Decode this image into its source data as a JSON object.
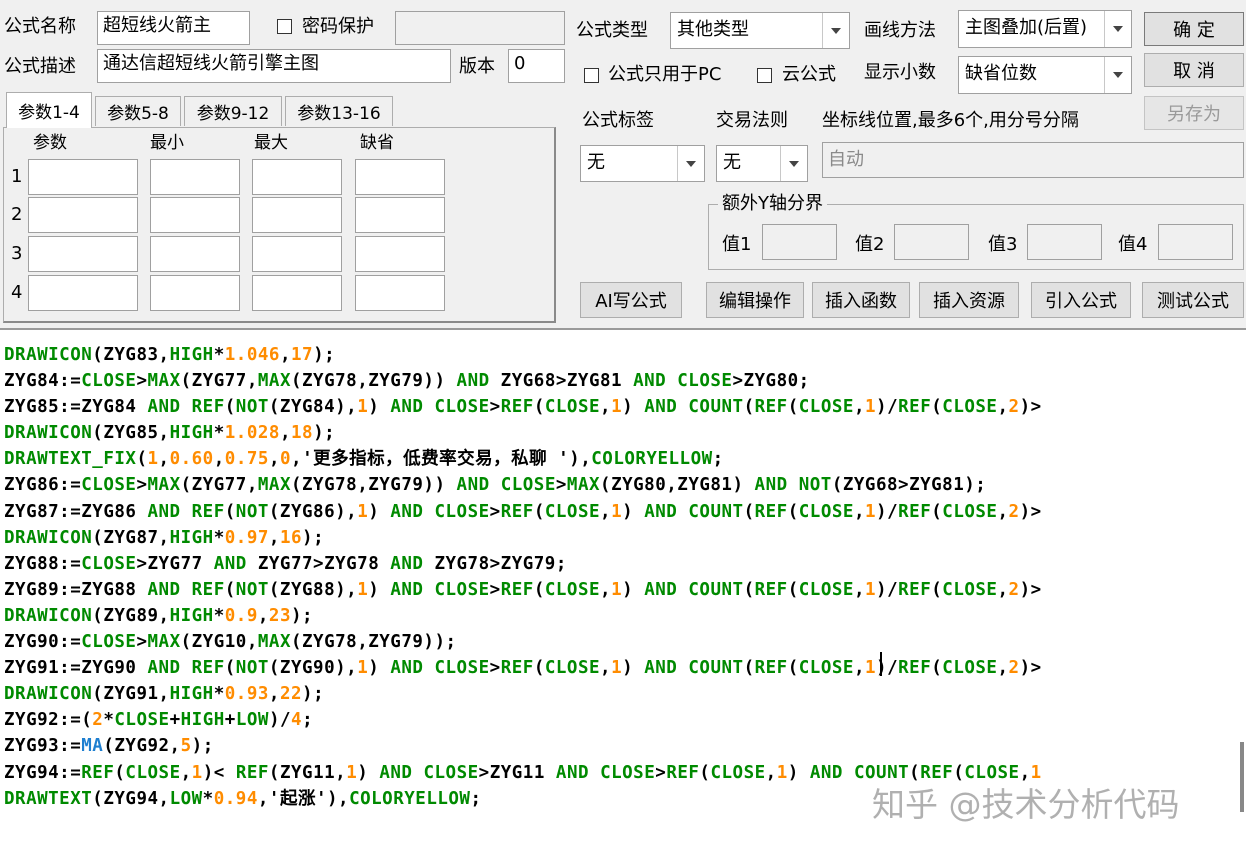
{
  "header": {
    "name_label": "公式名称",
    "name_value": "超短线火箭主",
    "password_label": "密码保护",
    "password_value": "",
    "desc_label": "公式描述",
    "desc_value": "通达信超短线火箭引擎主图",
    "version_label": "版本",
    "version_value": "0",
    "type_label": "公式类型",
    "type_value": "其他类型",
    "draw_label": "画线方法",
    "draw_value": "主图叠加(后置)",
    "pc_only_label": "公式只用于PC",
    "cloud_label": "云公式",
    "decimal_label": "显示小数",
    "decimal_value": "缺省位数"
  },
  "buttons": {
    "ok": "确  定",
    "cancel": "取  消",
    "save_as": "另存为"
  },
  "tabs": [
    {
      "label": "参数1-4",
      "active": true
    },
    {
      "label": "参数5-8",
      "active": false
    },
    {
      "label": "参数9-12",
      "active": false
    },
    {
      "label": "参数13-16",
      "active": false
    }
  ],
  "params": {
    "col_param": "参数",
    "col_min": "最小",
    "col_max": "最大",
    "col_default": "缺省",
    "rows": [
      "1",
      "2",
      "3",
      "4"
    ]
  },
  "right": {
    "tag_label": "公式标签",
    "tag_value": "无",
    "rule_label": "交易法则",
    "rule_value": "无",
    "axis_label": "坐标线位置,最多6个,用分号分隔",
    "axis_value": "自动",
    "extra_y_label": "额外Y轴分界",
    "v1_label": "值1",
    "v2_label": "值2",
    "v3_label": "值3",
    "v4_label": "值4"
  },
  "toolbar": {
    "ai": "AI写公式",
    "edit": "编辑操作",
    "insert_func": "插入函数",
    "insert_res": "插入资源",
    "import": "引入公式",
    "test": "测试公式"
  },
  "code_colors": {
    "normal": "#000000",
    "keyword": "#008a00",
    "number": "#ff8c00",
    "function_blue": "#1e7fd0"
  },
  "code_lines": [
    [
      [
        "g",
        "DRAWICON"
      ],
      [
        "n",
        "(ZYG83,"
      ],
      [
        "g",
        "HIGH"
      ],
      [
        "n",
        "*"
      ],
      [
        "o",
        "1.046"
      ],
      [
        "n",
        ","
      ],
      [
        "o",
        "17"
      ],
      [
        "n",
        ");"
      ]
    ],
    [
      [
        "n",
        "ZYG84:="
      ],
      [
        "g",
        "CLOSE"
      ],
      [
        "n",
        ">"
      ],
      [
        "g",
        "MAX"
      ],
      [
        "n",
        "(ZYG77,"
      ],
      [
        "g",
        "MAX"
      ],
      [
        "n",
        "(ZYG78,ZYG79)) "
      ],
      [
        "g",
        "AND"
      ],
      [
        "n",
        " ZYG68>ZYG81 "
      ],
      [
        "g",
        "AND"
      ],
      [
        "n",
        " "
      ],
      [
        "g",
        "CLOSE"
      ],
      [
        "n",
        ">ZYG80;"
      ]
    ],
    [
      [
        "n",
        "ZYG85:=ZYG84 "
      ],
      [
        "g",
        "AND"
      ],
      [
        "n",
        " "
      ],
      [
        "g",
        "REF"
      ],
      [
        "n",
        "("
      ],
      [
        "g",
        "NOT"
      ],
      [
        "n",
        "(ZYG84),"
      ],
      [
        "o",
        "1"
      ],
      [
        "n",
        ") "
      ],
      [
        "g",
        "AND"
      ],
      [
        "n",
        " "
      ],
      [
        "g",
        "CLOSE"
      ],
      [
        "n",
        ">"
      ],
      [
        "g",
        "REF"
      ],
      [
        "n",
        "("
      ],
      [
        "g",
        "CLOSE"
      ],
      [
        "n",
        ","
      ],
      [
        "o",
        "1"
      ],
      [
        "n",
        ") "
      ],
      [
        "g",
        "AND"
      ],
      [
        "n",
        " "
      ],
      [
        "g",
        "COUNT"
      ],
      [
        "n",
        "("
      ],
      [
        "g",
        "REF"
      ],
      [
        "n",
        "("
      ],
      [
        "g",
        "CLOSE"
      ],
      [
        "n",
        ","
      ],
      [
        "o",
        "1"
      ],
      [
        "n",
        ")/"
      ],
      [
        "g",
        "REF"
      ],
      [
        "n",
        "("
      ],
      [
        "g",
        "CLOSE"
      ],
      [
        "n",
        ","
      ],
      [
        "o",
        "2"
      ],
      [
        "n",
        ")>"
      ]
    ],
    [
      [
        "g",
        "DRAWICON"
      ],
      [
        "n",
        "(ZYG85,"
      ],
      [
        "g",
        "HIGH"
      ],
      [
        "n",
        "*"
      ],
      [
        "o",
        "1.028"
      ],
      [
        "n",
        ","
      ],
      [
        "o",
        "18"
      ],
      [
        "n",
        ");"
      ]
    ],
    [
      [
        "g",
        "DRAWTEXT_FIX"
      ],
      [
        "n",
        "("
      ],
      [
        "o",
        "1"
      ],
      [
        "n",
        ","
      ],
      [
        "o",
        "0.60"
      ],
      [
        "n",
        ","
      ],
      [
        "o",
        "0.75"
      ],
      [
        "n",
        ","
      ],
      [
        "o",
        "0"
      ],
      [
        "n",
        ",'更多指标，低费率交易，私聊 '),"
      ],
      [
        "g",
        "COLORYELLOW"
      ],
      [
        "n",
        ";"
      ]
    ],
    [
      [
        "n",
        "ZYG86:="
      ],
      [
        "g",
        "CLOSE"
      ],
      [
        "n",
        ">"
      ],
      [
        "g",
        "MAX"
      ],
      [
        "n",
        "(ZYG77,"
      ],
      [
        "g",
        "MAX"
      ],
      [
        "n",
        "(ZYG78,ZYG79)) "
      ],
      [
        "g",
        "AND"
      ],
      [
        "n",
        " "
      ],
      [
        "g",
        "CLOSE"
      ],
      [
        "n",
        ">"
      ],
      [
        "g",
        "MAX"
      ],
      [
        "n",
        "(ZYG80,ZYG81) "
      ],
      [
        "g",
        "AND"
      ],
      [
        "n",
        " "
      ],
      [
        "g",
        "NOT"
      ],
      [
        "n",
        "(ZYG68>ZYG81);"
      ]
    ],
    [
      [
        "n",
        "ZYG87:=ZYG86 "
      ],
      [
        "g",
        "AND"
      ],
      [
        "n",
        " "
      ],
      [
        "g",
        "REF"
      ],
      [
        "n",
        "("
      ],
      [
        "g",
        "NOT"
      ],
      [
        "n",
        "(ZYG86),"
      ],
      [
        "o",
        "1"
      ],
      [
        "n",
        ") "
      ],
      [
        "g",
        "AND"
      ],
      [
        "n",
        " "
      ],
      [
        "g",
        "CLOSE"
      ],
      [
        "n",
        ">"
      ],
      [
        "g",
        "REF"
      ],
      [
        "n",
        "("
      ],
      [
        "g",
        "CLOSE"
      ],
      [
        "n",
        ","
      ],
      [
        "o",
        "1"
      ],
      [
        "n",
        ") "
      ],
      [
        "g",
        "AND"
      ],
      [
        "n",
        " "
      ],
      [
        "g",
        "COUNT"
      ],
      [
        "n",
        "("
      ],
      [
        "g",
        "REF"
      ],
      [
        "n",
        "("
      ],
      [
        "g",
        "CLOSE"
      ],
      [
        "n",
        ","
      ],
      [
        "o",
        "1"
      ],
      [
        "n",
        ")/"
      ],
      [
        "g",
        "REF"
      ],
      [
        "n",
        "("
      ],
      [
        "g",
        "CLOSE"
      ],
      [
        "n",
        ","
      ],
      [
        "o",
        "2"
      ],
      [
        "n",
        ")>"
      ]
    ],
    [
      [
        "g",
        "DRAWICON"
      ],
      [
        "n",
        "(ZYG87,"
      ],
      [
        "g",
        "HIGH"
      ],
      [
        "n",
        "*"
      ],
      [
        "o",
        "0.97"
      ],
      [
        "n",
        ","
      ],
      [
        "o",
        "16"
      ],
      [
        "n",
        ");"
      ]
    ],
    [
      [
        "n",
        "ZYG88:="
      ],
      [
        "g",
        "CLOSE"
      ],
      [
        "n",
        ">ZYG77 "
      ],
      [
        "g",
        "AND"
      ],
      [
        "n",
        " ZYG77>ZYG78 "
      ],
      [
        "g",
        "AND"
      ],
      [
        "n",
        " ZYG78>ZYG79;"
      ]
    ],
    [
      [
        "n",
        "ZYG89:=ZYG88 "
      ],
      [
        "g",
        "AND"
      ],
      [
        "n",
        " "
      ],
      [
        "g",
        "REF"
      ],
      [
        "n",
        "("
      ],
      [
        "g",
        "NOT"
      ],
      [
        "n",
        "(ZYG88),"
      ],
      [
        "o",
        "1"
      ],
      [
        "n",
        ") "
      ],
      [
        "g",
        "AND"
      ],
      [
        "n",
        " "
      ],
      [
        "g",
        "CLOSE"
      ],
      [
        "n",
        ">"
      ],
      [
        "g",
        "REF"
      ],
      [
        "n",
        "("
      ],
      [
        "g",
        "CLOSE"
      ],
      [
        "n",
        ","
      ],
      [
        "o",
        "1"
      ],
      [
        "n",
        ") "
      ],
      [
        "g",
        "AND"
      ],
      [
        "n",
        " "
      ],
      [
        "g",
        "COUNT"
      ],
      [
        "n",
        "("
      ],
      [
        "g",
        "REF"
      ],
      [
        "n",
        "("
      ],
      [
        "g",
        "CLOSE"
      ],
      [
        "n",
        ","
      ],
      [
        "o",
        "1"
      ],
      [
        "n",
        ")/"
      ],
      [
        "g",
        "REF"
      ],
      [
        "n",
        "("
      ],
      [
        "g",
        "CLOSE"
      ],
      [
        "n",
        ","
      ],
      [
        "o",
        "2"
      ],
      [
        "n",
        ")>"
      ]
    ],
    [
      [
        "g",
        "DRAWICON"
      ],
      [
        "n",
        "(ZYG89,"
      ],
      [
        "g",
        "HIGH"
      ],
      [
        "n",
        "*"
      ],
      [
        "o",
        "0.9"
      ],
      [
        "n",
        ","
      ],
      [
        "o",
        "23"
      ],
      [
        "n",
        ");"
      ]
    ],
    [
      [
        "n",
        "ZYG90:="
      ],
      [
        "g",
        "CLOSE"
      ],
      [
        "n",
        ">"
      ],
      [
        "g",
        "MAX"
      ],
      [
        "n",
        "(ZYG10,"
      ],
      [
        "g",
        "MAX"
      ],
      [
        "n",
        "(ZYG78,ZYG79));"
      ]
    ],
    [
      [
        "n",
        "ZYG91:=ZYG90 "
      ],
      [
        "g",
        "AND"
      ],
      [
        "n",
        " "
      ],
      [
        "g",
        "REF"
      ],
      [
        "n",
        "("
      ],
      [
        "g",
        "NOT"
      ],
      [
        "n",
        "(ZYG90),"
      ],
      [
        "o",
        "1"
      ],
      [
        "n",
        ") "
      ],
      [
        "g",
        "AND"
      ],
      [
        "n",
        " "
      ],
      [
        "g",
        "CLOSE"
      ],
      [
        "n",
        ">"
      ],
      [
        "g",
        "REF"
      ],
      [
        "n",
        "("
      ],
      [
        "g",
        "CLOSE"
      ],
      [
        "n",
        ","
      ],
      [
        "o",
        "1"
      ],
      [
        "n",
        ") "
      ],
      [
        "g",
        "AND"
      ],
      [
        "n",
        " "
      ],
      [
        "g",
        "COUNT"
      ],
      [
        "n",
        "("
      ],
      [
        "g",
        "REF"
      ],
      [
        "n",
        "("
      ],
      [
        "g",
        "CLOSE"
      ],
      [
        "n",
        ","
      ],
      [
        "o",
        "1"
      ],
      [
        "n",
        ")/"
      ],
      [
        "g",
        "REF"
      ],
      [
        "n",
        "("
      ],
      [
        "g",
        "CLOSE"
      ],
      [
        "n",
        ","
      ],
      [
        "o",
        "2"
      ],
      [
        "n",
        ")>"
      ]
    ],
    [
      [
        "g",
        "DRAWICON"
      ],
      [
        "n",
        "(ZYG91,"
      ],
      [
        "g",
        "HIGH"
      ],
      [
        "n",
        "*"
      ],
      [
        "o",
        "0.93"
      ],
      [
        "n",
        ","
      ],
      [
        "o",
        "22"
      ],
      [
        "n",
        ");"
      ]
    ],
    [
      [
        "n",
        "ZYG92:=("
      ],
      [
        "o",
        "2"
      ],
      [
        "n",
        "*"
      ],
      [
        "g",
        "CLOSE"
      ],
      [
        "n",
        "+"
      ],
      [
        "g",
        "HIGH"
      ],
      [
        "n",
        "+"
      ],
      [
        "g",
        "LOW"
      ],
      [
        "n",
        ")/"
      ],
      [
        "o",
        "4"
      ],
      [
        "n",
        ";"
      ]
    ],
    [
      [
        "n",
        "ZYG93:="
      ],
      [
        "b",
        "MA"
      ],
      [
        "n",
        "(ZYG92,"
      ],
      [
        "o",
        "5"
      ],
      [
        "n",
        ");"
      ]
    ],
    [
      [
        "n",
        "ZYG94:="
      ],
      [
        "g",
        "REF"
      ],
      [
        "n",
        "("
      ],
      [
        "g",
        "CLOSE"
      ],
      [
        "n",
        ","
      ],
      [
        "o",
        "1"
      ],
      [
        "n",
        ")< "
      ],
      [
        "g",
        "REF"
      ],
      [
        "n",
        "(ZYG11,"
      ],
      [
        "o",
        "1"
      ],
      [
        "n",
        ") "
      ],
      [
        "g",
        "AND"
      ],
      [
        "n",
        " "
      ],
      [
        "g",
        "CLOSE"
      ],
      [
        "n",
        ">ZYG11 "
      ],
      [
        "g",
        "AND"
      ],
      [
        "n",
        " "
      ],
      [
        "g",
        "CLOSE"
      ],
      [
        "n",
        ">"
      ],
      [
        "g",
        "REF"
      ],
      [
        "n",
        "("
      ],
      [
        "g",
        "CLOSE"
      ],
      [
        "n",
        ","
      ],
      [
        "o",
        "1"
      ],
      [
        "n",
        ") "
      ],
      [
        "g",
        "AND"
      ],
      [
        "n",
        " "
      ],
      [
        "g",
        "COUNT"
      ],
      [
        "n",
        "("
      ],
      [
        "g",
        "REF"
      ],
      [
        "n",
        "("
      ],
      [
        "g",
        "CLOSE"
      ],
      [
        "n",
        ","
      ],
      [
        "o",
        "1"
      ]
    ],
    [
      [
        "g",
        "DRAWTEXT"
      ],
      [
        "n",
        "(ZYG94,"
      ],
      [
        "g",
        "LOW"
      ],
      [
        "n",
        "*"
      ],
      [
        "o",
        "0.94"
      ],
      [
        "n",
        ",'起涨'),"
      ],
      [
        "g",
        "COLORYELLOW"
      ],
      [
        "n",
        ";"
      ]
    ]
  ],
  "watermark": "知乎 @技术分析代码"
}
